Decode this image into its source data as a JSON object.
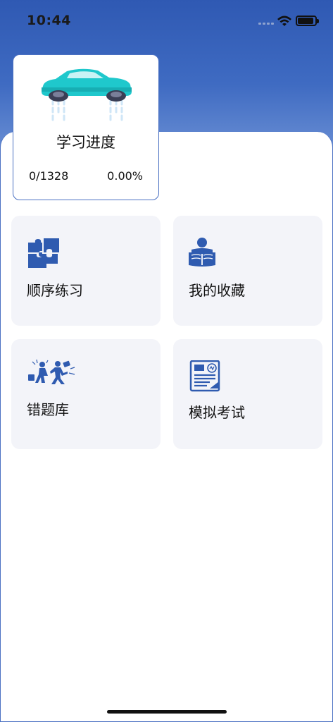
{
  "status_bar": {
    "time": "10:44"
  },
  "progress": {
    "title": "学习进度",
    "count": "0/1328",
    "percent": "0.00%"
  },
  "menu": {
    "items": [
      {
        "label": "顺序练习",
        "icon": "puzzle-icon"
      },
      {
        "label": "我的收藏",
        "icon": "reading-person-icon"
      },
      {
        "label": "错题库",
        "icon": "running-people-icon"
      },
      {
        "label": "模拟考试",
        "icon": "exam-paper-icon"
      }
    ]
  },
  "colors": {
    "accent": "#2f59b3",
    "tile_bg": "#f3f4f9",
    "icon_blue": "#2f5bb0",
    "car": "#1fc8cc"
  }
}
